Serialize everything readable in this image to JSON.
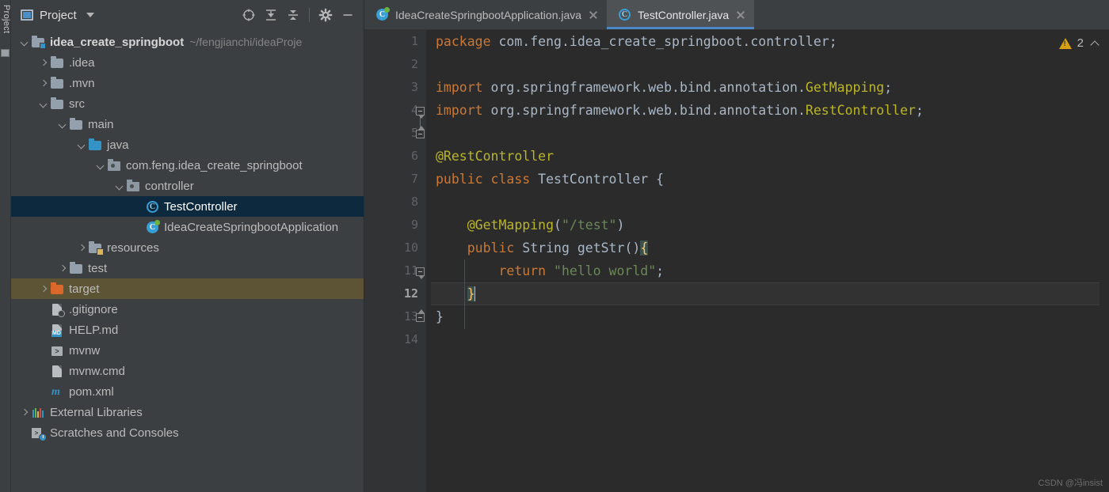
{
  "tool_stripe": {
    "label": "Project"
  },
  "project_panel": {
    "title": "Project",
    "actions": [
      {
        "name": "select-opened-file-icon",
        "glyph": "locate"
      },
      {
        "name": "expand-all-icon",
        "glyph": "expand"
      },
      {
        "name": "collapse-all-icon",
        "glyph": "collapse"
      },
      {
        "name": "settings-gear-icon",
        "glyph": "gear"
      },
      {
        "name": "hide-panel-icon",
        "glyph": "minimize"
      }
    ],
    "tree": [
      {
        "label": "idea_create_springboot",
        "path": "~/fengjianchi/ideaProje",
        "indent": 0,
        "arrow": "down",
        "icon": "module",
        "bold": true,
        "state": "none"
      },
      {
        "label": ".idea",
        "indent": 1,
        "arrow": "right",
        "icon": "folder",
        "state": "none"
      },
      {
        "label": ".mvn",
        "indent": 1,
        "arrow": "right",
        "icon": "folder",
        "state": "none"
      },
      {
        "label": "src",
        "indent": 1,
        "arrow": "down",
        "icon": "folder",
        "state": "none"
      },
      {
        "label": "main",
        "indent": 2,
        "arrow": "down",
        "icon": "folder",
        "state": "none"
      },
      {
        "label": "java",
        "indent": 3,
        "arrow": "down",
        "icon": "folder-blue",
        "state": "none"
      },
      {
        "label": "com.feng.idea_create_springboot",
        "indent": 4,
        "arrow": "down",
        "icon": "package",
        "state": "none"
      },
      {
        "label": "controller",
        "indent": 5,
        "arrow": "down",
        "icon": "package",
        "state": "none"
      },
      {
        "label": "TestController",
        "indent": 6,
        "arrow": "none",
        "icon": "class",
        "state": "selected"
      },
      {
        "label": "IdeaCreateSpringbootApplication",
        "indent": 6,
        "arrow": "none",
        "icon": "class-spring",
        "state": "none"
      },
      {
        "label": "resources",
        "indent": 3,
        "arrow": "right",
        "icon": "folder-resources",
        "state": "none"
      },
      {
        "label": "test",
        "indent": 2,
        "arrow": "right",
        "icon": "folder",
        "state": "none"
      },
      {
        "label": "target",
        "indent": 1,
        "arrow": "right",
        "icon": "folder-orange",
        "state": "marked"
      },
      {
        "label": ".gitignore",
        "indent": 1,
        "arrow": "none",
        "icon": "gitignore",
        "state": "none"
      },
      {
        "label": "HELP.md",
        "indent": 1,
        "arrow": "none",
        "icon": "markdown",
        "state": "none"
      },
      {
        "label": "mvnw",
        "indent": 1,
        "arrow": "none",
        "icon": "shell",
        "state": "none"
      },
      {
        "label": "mvnw.cmd",
        "indent": 1,
        "arrow": "none",
        "icon": "file",
        "state": "none"
      },
      {
        "label": "pom.xml",
        "indent": 1,
        "arrow": "none",
        "icon": "maven",
        "state": "none"
      },
      {
        "label": "External Libraries",
        "indent": 0,
        "arrow": "right",
        "icon": "libraries",
        "state": "none"
      },
      {
        "label": "Scratches and Consoles",
        "indent": 0,
        "arrow": "none",
        "icon": "scratches",
        "state": "none"
      }
    ]
  },
  "editor": {
    "tabs": [
      {
        "label": "IdeaCreateSpringbootApplication.java",
        "icon": "class-spring",
        "active": false
      },
      {
        "label": "TestController.java",
        "icon": "class-ring",
        "active": true
      }
    ],
    "inspection": {
      "warning_count": "2",
      "chevron": "chevron-up-icon"
    },
    "gutter_numbers": [
      "1",
      "2",
      "3",
      "4",
      "5",
      "6",
      "7",
      "8",
      "9",
      "10",
      "11",
      "12",
      "13",
      "14"
    ],
    "current_line": 12,
    "lines": [
      {
        "n": 1,
        "tokens": [
          {
            "t": "package",
            "c": "kw"
          },
          {
            "t": " com.feng.idea_create_springboot.controller;",
            "c": "gray"
          }
        ]
      },
      {
        "n": 2,
        "tokens": []
      },
      {
        "n": 3,
        "tokens": [
          {
            "t": "import",
            "c": "kw"
          },
          {
            "t": " org.springframework.web.bind.annotation.",
            "c": "gray"
          },
          {
            "t": "GetMapping",
            "c": "ann"
          },
          {
            "t": ";",
            "c": "gray"
          }
        ]
      },
      {
        "n": 4,
        "tokens": [
          {
            "t": "import",
            "c": "kw"
          },
          {
            "t": " org.springframework.web.bind.annotation.",
            "c": "gray"
          },
          {
            "t": "RestController",
            "c": "ann"
          },
          {
            "t": ";",
            "c": "gray"
          }
        ]
      },
      {
        "n": 5,
        "tokens": []
      },
      {
        "n": 6,
        "tokens": [
          {
            "t": "@RestController",
            "c": "ann"
          }
        ]
      },
      {
        "n": 7,
        "tokens": [
          {
            "t": "public class",
            "c": "kw"
          },
          {
            "t": " TestController {",
            "c": "cls2"
          }
        ]
      },
      {
        "n": 8,
        "tokens": []
      },
      {
        "n": 9,
        "tokens": [
          {
            "t": "    @GetMapping",
            "c": "ann"
          },
          {
            "t": "(",
            "c": "gray"
          },
          {
            "t": "\"/test\"",
            "c": "str"
          },
          {
            "t": ")",
            "c": "gray"
          }
        ]
      },
      {
        "n": 10,
        "tokens": [
          {
            "t": "    public",
            "c": "kw"
          },
          {
            "t": " String",
            "c": "cls2"
          },
          {
            "t": " getStr",
            "c": "id"
          },
          {
            "t": "()",
            "c": "gray"
          },
          {
            "t": "{",
            "c": "brace-hl"
          }
        ]
      },
      {
        "n": 11,
        "tokens": [
          {
            "t": "        return",
            "c": "kw"
          },
          {
            "t": " ",
            "c": "gray"
          },
          {
            "t": "\"hello world\"",
            "c": "str"
          },
          {
            "t": ";",
            "c": "gray"
          }
        ]
      },
      {
        "n": 12,
        "tokens": [
          {
            "t": "    ",
            "c": "gray"
          },
          {
            "t": "}",
            "c": "brace-hl"
          }
        ]
      },
      {
        "n": 13,
        "tokens": [
          {
            "t": "}",
            "c": "gray"
          }
        ]
      },
      {
        "n": 14,
        "tokens": []
      }
    ]
  },
  "watermark": "CSDN @冯insist",
  "colors": {
    "panel_bg": "#3c3f41",
    "editor_bg": "#2b2b2b",
    "gutter_bg": "#313335",
    "selection": "#0d293e",
    "marked_row": "#5c5435",
    "tab_active": "#4e5254",
    "tab_underline": "#4a88c7",
    "keyword": "#cc7832",
    "annotation": "#bbb529",
    "string": "#6a8759",
    "text": "#a9b7c6",
    "warning": "#d8a010"
  }
}
